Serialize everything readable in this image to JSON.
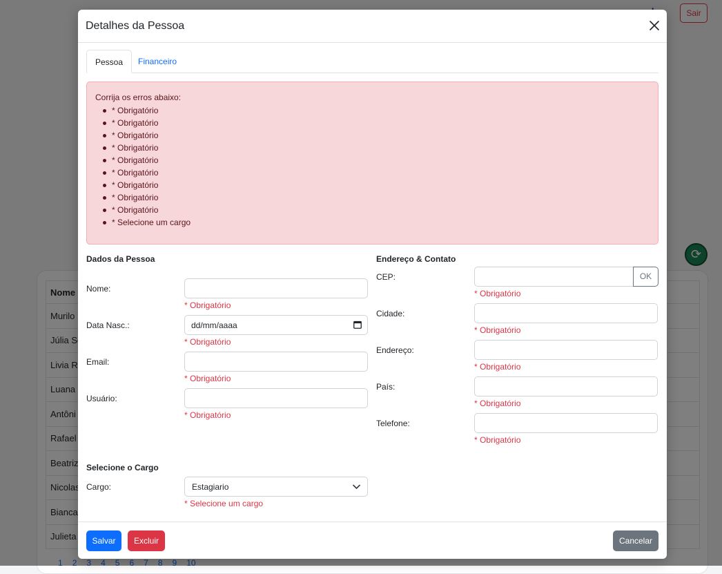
{
  "background": {
    "greeting_tail": "!",
    "logout_label": "Sair",
    "table_header": "Nome",
    "rows": [
      "Murilo",
      "Júlia Sc",
      "Livia Ro",
      "Luana",
      "Antôni",
      "Rafael",
      "Beatriz",
      "Nicolas",
      "Bianca",
      "Julieta"
    ],
    "pages": [
      "1",
      "2",
      "3",
      "4",
      "5",
      "6",
      "7",
      "8",
      "9",
      "10"
    ]
  },
  "modal": {
    "title": "Detalhes da Pessoa",
    "tabs": [
      {
        "label": "Pessoa",
        "active": true
      },
      {
        "label": "Financeiro",
        "active": false
      }
    ],
    "alert": {
      "title": "Corrija os erros abaixo:",
      "items": [
        "* Obrigatório",
        "* Obrigatório",
        "* Obrigatório",
        "* Obrigatório",
        "* Obrigatório",
        "* Obrigatório",
        "* Obrigatório",
        "* Obrigatório",
        "* Obrigatório",
        "* Selecione um cargo"
      ]
    },
    "personal": {
      "section_title": "Dados da Pessoa",
      "name_label": "Nome:",
      "name_value": "",
      "name_error": "* Obrigatório",
      "birth_label": "Data Nasc.:",
      "birth_placeholder": "dd/mm/aaaa",
      "birth_error": "* Obrigatório",
      "email_label": "Email:",
      "email_value": "",
      "email_error": "* Obrigatório",
      "user_label": "Usuário:",
      "user_value": "",
      "user_error": "* Obrigatório"
    },
    "address": {
      "section_title": "Endereço & Contato",
      "cep_label": "CEP:",
      "cep_value": "",
      "cep_button": "OK",
      "cep_error": "* Obrigatório",
      "city_label": "Cidade:",
      "city_value": "",
      "city_error": "* Obrigatório",
      "street_label": "Endereço:",
      "street_value": "",
      "street_error": "* Obrigatório",
      "country_label": "País:",
      "country_value": "",
      "country_error": "* Obrigatório",
      "phone_label": "Telefone:",
      "phone_value": "",
      "phone_error": "* Obrigatório"
    },
    "role": {
      "section_title": "Selecione o Cargo",
      "label": "Cargo:",
      "selected": "Estagiario",
      "error": "* Selecione um cargo"
    },
    "footer": {
      "save_label": "Salvar",
      "delete_label": "Excluir",
      "cancel_label": "Cancelar"
    }
  }
}
